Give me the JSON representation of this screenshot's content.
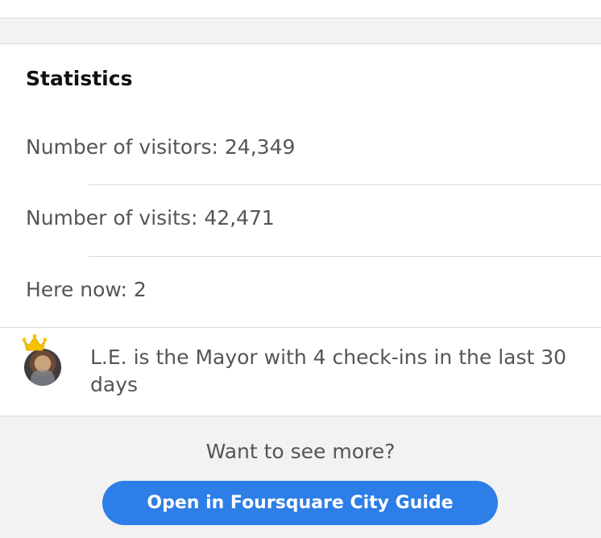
{
  "statistics": {
    "title": "Statistics",
    "visitors": "Number of visitors: 24,349",
    "visits": "Number of visits: 42,471",
    "here_now": "Here now: 2"
  },
  "mayor": {
    "text": "L.E. is the Mayor with 4 check-ins in the last 30 days",
    "icon": "crown-icon"
  },
  "footer": {
    "prompt": "Want to see more?",
    "button_label": "Open in Foursquare City Guide"
  },
  "colors": {
    "accent": "#2d7ee6",
    "crown": "#f5c400",
    "background": "#f2f2f2"
  }
}
